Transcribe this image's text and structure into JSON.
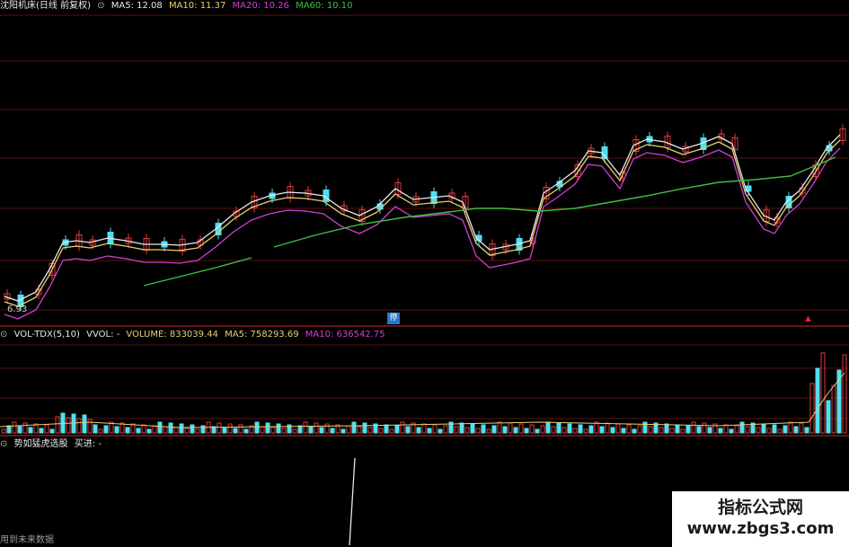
{
  "main_header": {
    "title": "沈阳机床(日线 前复权)",
    "ma5": "MA5: 12.08",
    "ma10": "MA10: 11.37",
    "ma20": "MA20: 10.26",
    "ma60": "MA60: 10.10"
  },
  "low_price_label": "6.93",
  "stop_badge": "停",
  "vol_header": {
    "name": "VOL-TDX(5,10)",
    "vvol": "VVOL: -",
    "volume": "VOLUME: 833039.44",
    "ma5": "MA5: 758293.69",
    "ma10": "MA10: 636542.75"
  },
  "ind_header": {
    "name": "势如猛虎选股",
    "buy": "买进: -"
  },
  "footer_text": "用到未来数据",
  "watermark": {
    "title": "指标公式网",
    "url": "www.zbgs3.com"
  },
  "colors": {
    "up": "#e03a3a",
    "down": "#4fe0f0",
    "ma5": "#e8e8e8",
    "ma10": "#e8d070",
    "ma20": "#d040d0",
    "ma60": "#40c040",
    "grid": "#5a1010"
  },
  "icons": [
    "collapse-icon",
    "limit-up-arrow-icon"
  ]
}
